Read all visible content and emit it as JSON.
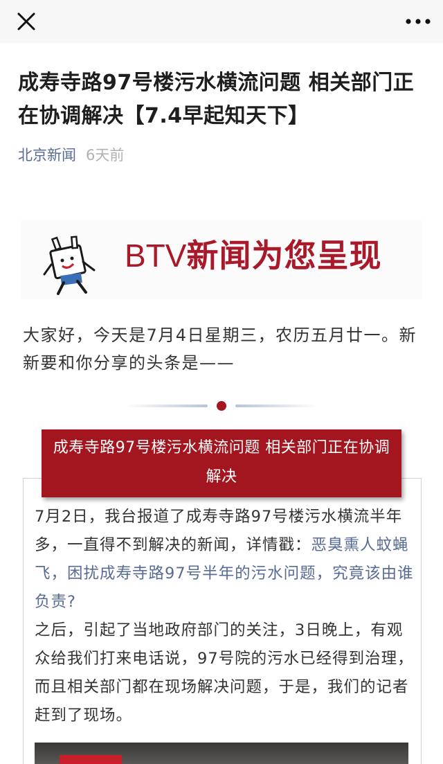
{
  "article": {
    "title": "成寿寺路97号楼污水横流问题 相关部门正在协调解决【7.4早起知天下】",
    "source": "北京新闻",
    "time": "6天前"
  },
  "banner": {
    "brand": "BTV",
    "text": "新闻为您呈现"
  },
  "intro": "大家好，今天是7月4日星期三，农历五月廿一。新新要和你分享的头条是——",
  "section": {
    "headline": "成寿寺路97号楼污水横流问题 相关部门正在协调解决",
    "para1": "7月2日，我台报道了成寿寺路97号楼污水横流半年多，一直得不到解决的新闻，详情戳：",
    "link": "恶臭熏人蚊蝇飞，困扰成寿寺路97号半年的污水问题，究竟该由谁负责?",
    "para2": "之后，引起了当地政府部门的关注，3日晚上，有观众给我们打来电话说，97号院的污水已经得到治理，而且相关部门都在现场解决问题，于是，我们的记者赶到了现场。"
  },
  "colors": {
    "accent_red": "#a3161f",
    "link_blue": "#576b95"
  }
}
